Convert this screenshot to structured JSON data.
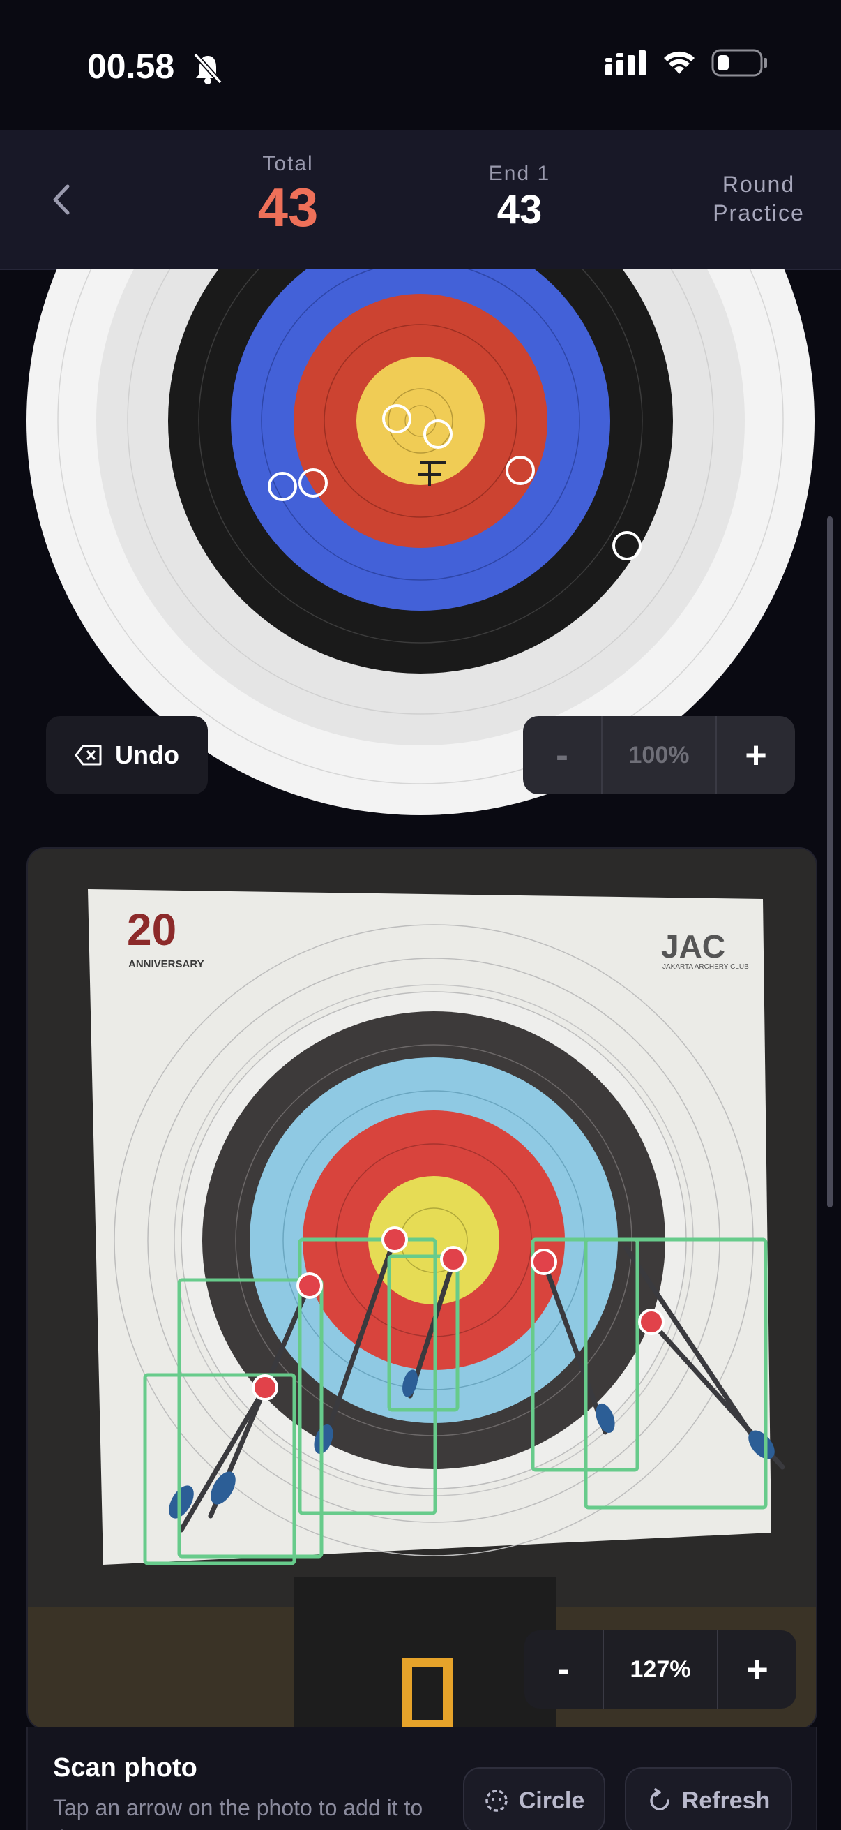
{
  "status_bar": {
    "time": "00.58",
    "icons": [
      "bell-slash-icon",
      "cellular-signal-icon",
      "wifi-icon",
      "battery-icon"
    ]
  },
  "header": {
    "back_icon": "chevron-left-icon",
    "total_label": "Total",
    "total_value": "43",
    "end_label": "End 1",
    "end_value": "43",
    "round_label": "Round",
    "round_value": "Practice"
  },
  "target_controls": {
    "undo_label": "Undo",
    "undo_icon": "backspace-icon",
    "zoom_minus": "-",
    "zoom_value": "100%",
    "zoom_plus": "+"
  },
  "photo": {
    "logo_left_text": "ANNIVERSARY",
    "logo_left_number": "20",
    "logo_right_text": "JAC",
    "logo_right_subtext": "JAKARTA ARCHERY CLUB",
    "zoom_minus": "-",
    "zoom_value": "127%",
    "zoom_plus": "+"
  },
  "scan": {
    "title": "Scan photo",
    "hint": "Tap an arrow on the photo to add it to the target",
    "circle_label": "Circle",
    "circle_icon": "circle-dashed-icon",
    "refresh_label": "Refresh",
    "refresh_icon": "refresh-icon"
  },
  "colors": {
    "accent_total": "#ee7059",
    "target_blue": "#4361d8",
    "target_red": "#cc4331",
    "target_gold": "#f0cc55",
    "box_green": "#67cb8b",
    "marker_red": "#e1424a"
  }
}
